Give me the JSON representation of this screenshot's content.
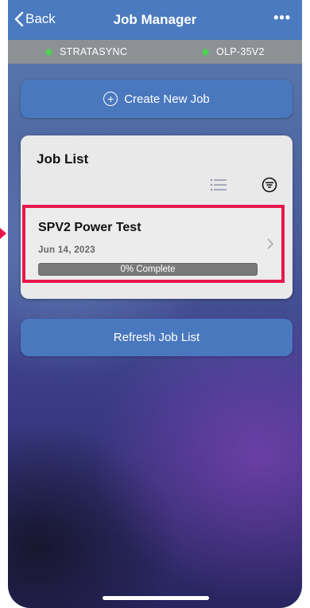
{
  "nav": {
    "back_label": "Back",
    "title": "Job Manager",
    "more_label": "•••"
  },
  "status": {
    "left": {
      "label": "STRATASYNC",
      "color": "#4ed44e"
    },
    "right": {
      "label": "OLP-35V2",
      "color": "#4ed44e"
    }
  },
  "create_button": {
    "label": "Create New Job",
    "icon": "plus-circle-icon"
  },
  "job_list": {
    "heading": "Job List",
    "icons": [
      "list-icon",
      "filter-icon"
    ],
    "jobs": [
      {
        "name": "SPV2 Power Test",
        "date": "Jun 14, 2023",
        "progress_percent": 0,
        "progress_label": "0% Complete"
      }
    ]
  },
  "refresh_button": {
    "label": "Refresh Job List"
  },
  "colors": {
    "accent": "#4a78bf",
    "highlight": "#e8174a",
    "status_dot": "#4ed44e"
  }
}
